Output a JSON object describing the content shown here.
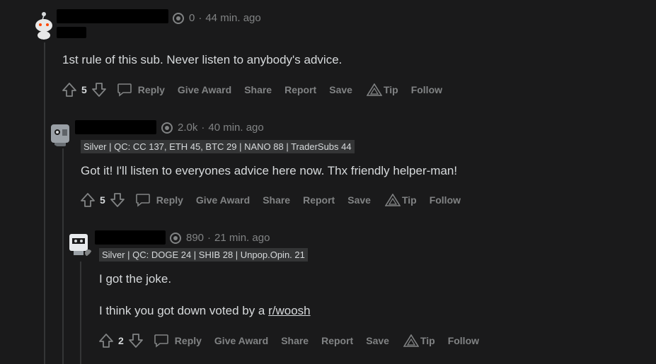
{
  "comments": [
    {
      "points": "0",
      "time": "44 min. ago",
      "flair": "",
      "body": [
        "1st rule of this sub. Never listen to anybody's advice."
      ],
      "score": "5",
      "actions": {
        "reply": "Reply",
        "give_award": "Give Award",
        "share": "Share",
        "report": "Report",
        "save": "Save",
        "tip": "Tip",
        "follow": "Follow"
      }
    },
    {
      "points": "2.0k",
      "time": "40 min. ago",
      "flair": "Silver | QC: CC 137, ETH 45, BTC 29 | NANO 88 | TraderSubs 44",
      "body": [
        "Got it! I'll listen to everyones advice here now. Thx friendly helper-man!"
      ],
      "score": "5",
      "actions": {
        "reply": "Reply",
        "give_award": "Give Award",
        "share": "Share",
        "report": "Report",
        "save": "Save",
        "tip": "Tip",
        "follow": "Follow"
      }
    },
    {
      "points": "890",
      "time": "21 min. ago",
      "flair": "Silver | QC: DOGE 24 | SHIB 28 | Unpop.Opin. 21",
      "body": [
        "I got the joke.",
        "I think you got down voted by a "
      ],
      "link": "r/woosh",
      "score": "2",
      "actions": {
        "reply": "Reply",
        "give_award": "Give Award",
        "share": "Share",
        "report": "Report",
        "save": "Save",
        "tip": "Tip",
        "follow": "Follow"
      }
    }
  ],
  "colors": {
    "background": "#1a1a1b",
    "text": "#d7dadc",
    "muted": "#818384",
    "flair_bg": "#343536"
  }
}
